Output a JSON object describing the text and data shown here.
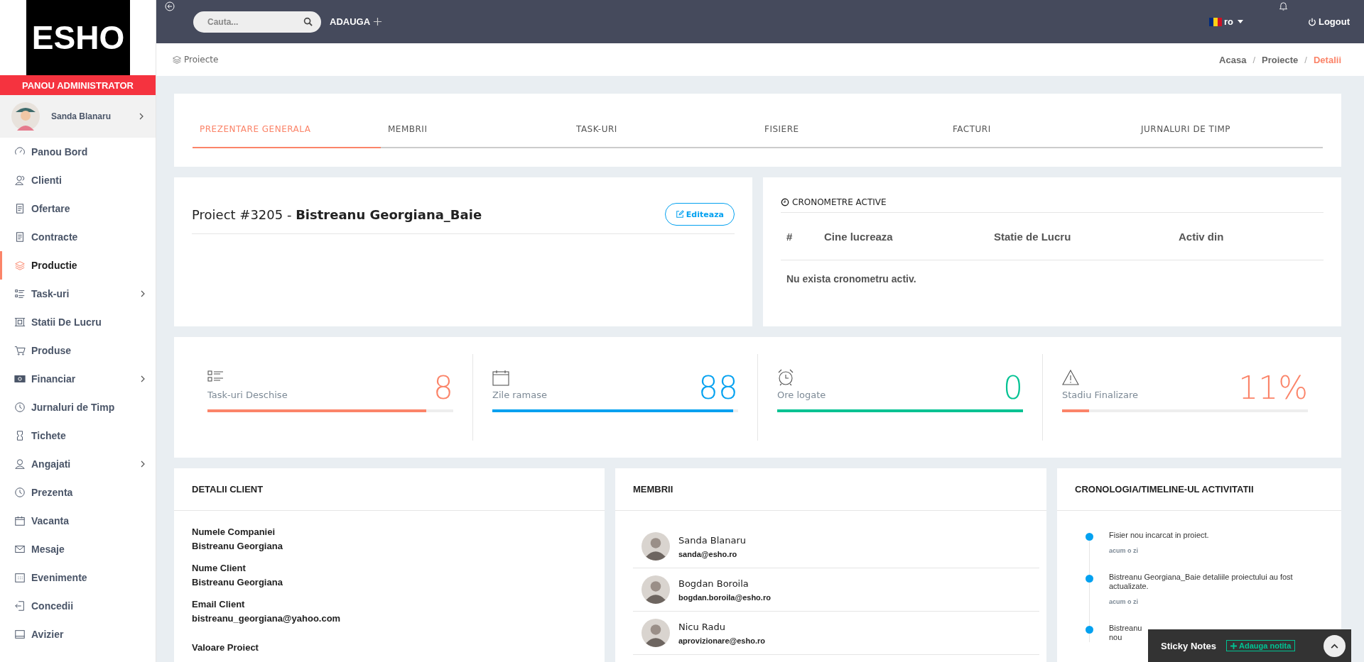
{
  "sidebar": {
    "logo": "ESHO",
    "panel_label": "PANOU ADMINISTRATOR",
    "user": {
      "name": "Sanda Blanaru"
    },
    "items": [
      {
        "label": "Panou Bord",
        "has_children": false,
        "selected": false
      },
      {
        "label": "Clienti",
        "has_children": false,
        "selected": false
      },
      {
        "label": "Ofertare",
        "has_children": false,
        "selected": false
      },
      {
        "label": "Contracte",
        "has_children": false,
        "selected": false
      },
      {
        "label": "Productie",
        "has_children": false,
        "selected": true
      },
      {
        "label": "Task-uri",
        "has_children": true,
        "selected": false
      },
      {
        "label": "Statii De Lucru",
        "has_children": false,
        "selected": false
      },
      {
        "label": "Produse",
        "has_children": false,
        "selected": false
      },
      {
        "label": "Financiar",
        "has_children": true,
        "selected": false
      },
      {
        "label": "Jurnaluri de Timp",
        "has_children": false,
        "selected": false
      },
      {
        "label": "Tichete",
        "has_children": false,
        "selected": false
      },
      {
        "label": "Angajati",
        "has_children": true,
        "selected": false
      },
      {
        "label": "Prezenta",
        "has_children": false,
        "selected": false
      },
      {
        "label": "Vacanta",
        "has_children": false,
        "selected": false
      },
      {
        "label": "Mesaje",
        "has_children": false,
        "selected": false
      },
      {
        "label": "Evenimente",
        "has_children": false,
        "selected": false
      },
      {
        "label": "Concedii",
        "has_children": false,
        "selected": false
      },
      {
        "label": "Avizier",
        "has_children": false,
        "selected": false
      }
    ]
  },
  "topbar": {
    "search": {
      "placeholder": "Cauta..."
    },
    "add_label": "ADAUGA",
    "language": "ro",
    "logout": "Logout"
  },
  "breadcrumb": {
    "page_title": "Proiecte",
    "separator": [
      "/",
      "/"
    ],
    "items": [
      {
        "label": "Acasa",
        "selected": false
      },
      {
        "label": "Proiecte",
        "selected": false
      },
      {
        "label": "Detalii",
        "selected": true
      }
    ]
  },
  "tabs": [
    {
      "label": "PREZENTARE GENERALA",
      "selected": true
    },
    {
      "label": "MEMBRII",
      "selected": false
    },
    {
      "label": "TASK-URI",
      "selected": false
    },
    {
      "label": "FISIERE",
      "selected": false
    },
    {
      "label": "FACTURI",
      "selected": false
    },
    {
      "label": "JURNALURI DE TIMP",
      "selected": false
    }
  ],
  "project": {
    "title": "Proiect #3205 - **Bistreanu Georgiana_Baie**",
    "edit_button": "Editeaza"
  },
  "timers": {
    "title": "CRONOMETRE ACTIVE",
    "columns": [
      "#",
      "Cine lucreaza",
      "Statie de Lucru",
      "Activ din"
    ],
    "empty_message": "Nu exista cronometru activ."
  },
  "stats": [
    {
      "label": "Task-uri Deschise",
      "value": "8",
      "level": 0.89,
      "color": "#fb8469"
    },
    {
      "label": "Zile ramase",
      "value": "88",
      "level": 0.98,
      "color": "#03a1f0"
    },
    {
      "label": "Ore logate",
      "value": "0",
      "level": 1,
      "color": "#00c292"
    },
    {
      "label": "Stadiu Finalizare",
      "value": "11%",
      "level": 0.11,
      "color": "#fb8469"
    }
  ],
  "client_details": {
    "title": "DETALII CLIENT",
    "fields": [
      {
        "label": "Numele Companiei",
        "value": "Bistreanu Georgiana"
      },
      {
        "label": "Nume Client",
        "value": "Bistreanu Georgiana"
      },
      {
        "label": "Email Client",
        "value": "bistreanu_georgiana@yahoo.com"
      },
      {
        "label": "Valoare Proiect"
      }
    ]
  },
  "members": {
    "title": "MEMBRII",
    "items": [
      {
        "name": "Sanda Blanaru",
        "email": "sanda@esho.ro"
      },
      {
        "name": "Bogdan Boroila",
        "email": "bogdan.boroila@esho.ro"
      },
      {
        "name": "Nicu Radu",
        "email": "aprovizionare@esho.ro"
      }
    ]
  },
  "timeline": {
    "title": "CRONOLOGIA/TIMELINE-UL ACTIVITATII",
    "items": [
      {
        "lines": [
          "Fisier nou incarcat in proiect."
        ],
        "time": "acum o zi"
      },
      {
        "lines": [
          "Bistreanu Georgiana_Baie detaliile proiectului au fost actualizate."
        ],
        "time": "acum o zi"
      },
      {
        "lines": [
          "Bistreanu",
          "nou"
        ]
      }
    ]
  },
  "sticky_notes": {
    "title": "Sticky Notes",
    "add_button": "Adauga notita"
  }
}
